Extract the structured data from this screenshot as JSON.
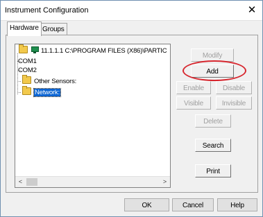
{
  "window": {
    "title": "Instrument Configuration"
  },
  "tabs": [
    {
      "label": "Hardware",
      "active": true
    },
    {
      "label": "Groups",
      "active": false
    }
  ],
  "tree": {
    "root_label": "11.1.1.1 C:\\PROGRAM FILES (X86)\\PARTIC",
    "items": [
      {
        "label": "COM1"
      },
      {
        "label": "COM2"
      },
      {
        "label": "Other Sensors:"
      },
      {
        "label": "Network:",
        "selected": true
      }
    ]
  },
  "side_buttons": {
    "modify": "Modify",
    "add": "Add",
    "enable": "Enable",
    "disable": "Disable",
    "visible": "Visible",
    "invisible": "Invisible",
    "delete": "Delete",
    "search": "Search",
    "print": "Print"
  },
  "dialog_buttons": {
    "ok": "OK",
    "cancel": "Cancel",
    "help": "Help"
  },
  "colors": {
    "highlight": "#d7262e",
    "selection": "#0a64d2"
  },
  "icons": {
    "close": "close-icon",
    "folder": "folder-icon",
    "network": "network-computer-icon"
  }
}
